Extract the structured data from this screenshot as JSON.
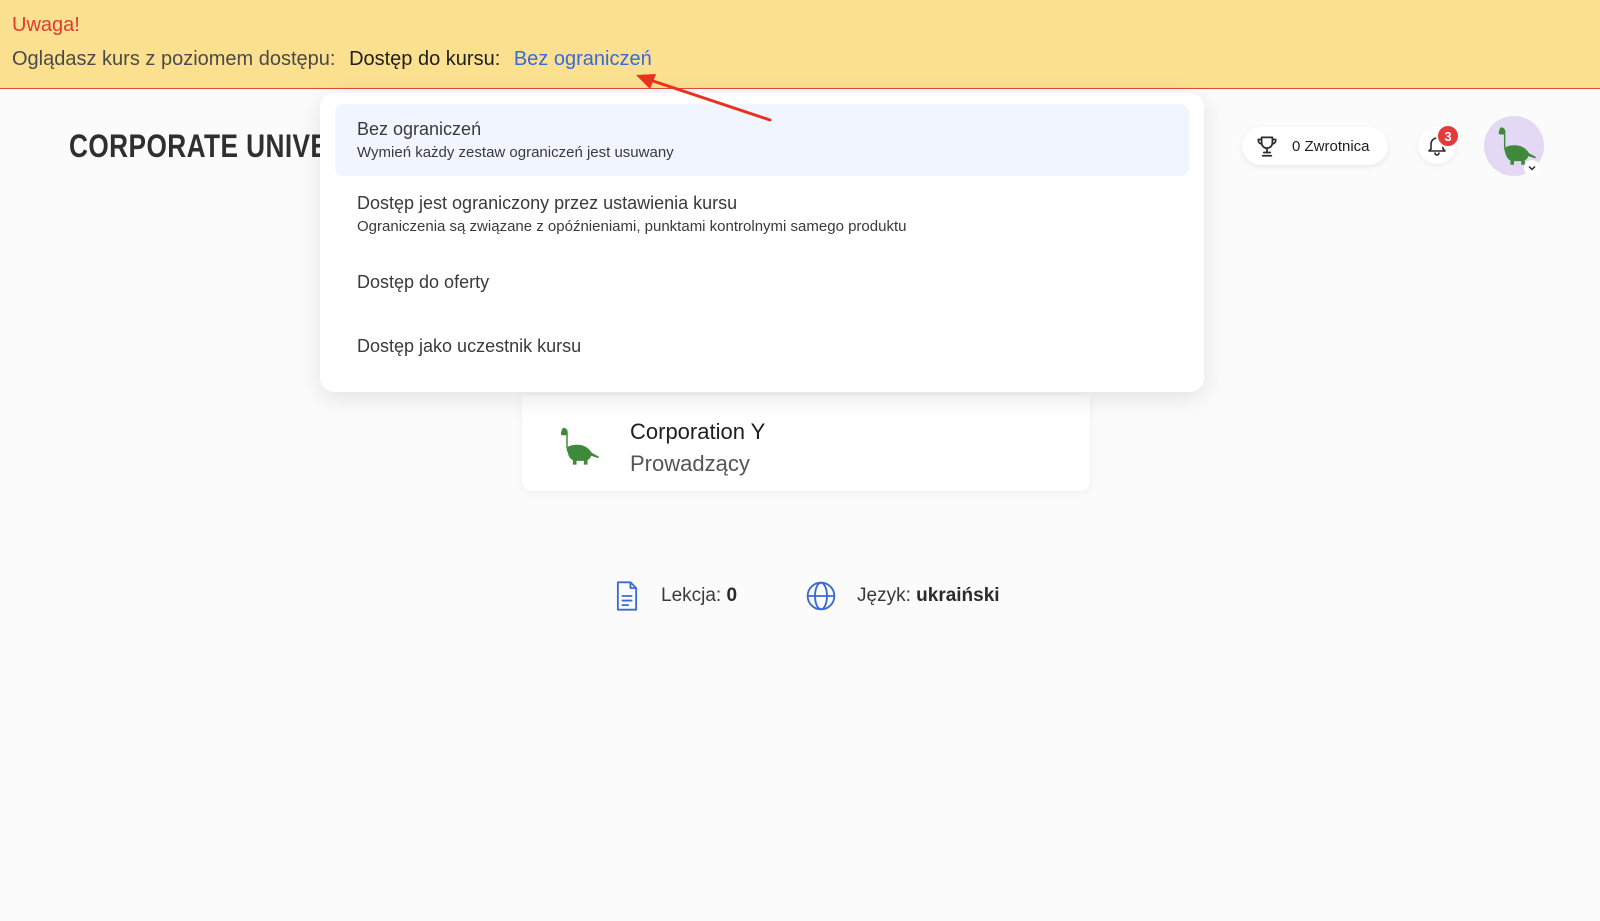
{
  "banner": {
    "title": "Uwaga!",
    "prefix": "Oglądasz kurs z poziomem dostępu:",
    "access_label": "Dostęp do kursu:",
    "access_value": "Bez ograniczeń"
  },
  "header": {
    "brand": "CORPORATE UNIVERS",
    "points_label": "0 Zwrotnica",
    "notifications_count": "3"
  },
  "dropdown": {
    "options": [
      {
        "label": "Bez ograniczeń",
        "description": "Wymień każdy zestaw ograniczeń jest usuwany",
        "selected": true
      },
      {
        "label": "Dostęp jest ograniczony przez ustawienia kursu",
        "description": "Ograniczenia są związane z opóźnieniami, punktami kontrolnymi samego produktu",
        "selected": false
      },
      {
        "label": "Dostęp do oferty",
        "description": "",
        "selected": false
      },
      {
        "label": "Dostęp jako uczestnik kursu",
        "description": "",
        "selected": false
      }
    ]
  },
  "instructor": {
    "name": "Corporation Y",
    "role": "Prowadzący"
  },
  "meta": {
    "lessons_label": "Lekcja:",
    "lessons_value": "0",
    "language_label": "Język:",
    "language_value": "ukraiński"
  },
  "colors": {
    "banner_bg": "#fae08f",
    "warning_red": "#e23b2e",
    "link_blue": "#3a6ad6",
    "selected_bg": "#f0f5ff",
    "dino_green": "#3f8a3a",
    "avatar_bg": "#e4d9f4"
  },
  "icons": [
    "trophy-icon",
    "bell-icon",
    "dinosaur-icon",
    "chevron-down-icon",
    "document-icon",
    "globe-icon"
  ]
}
